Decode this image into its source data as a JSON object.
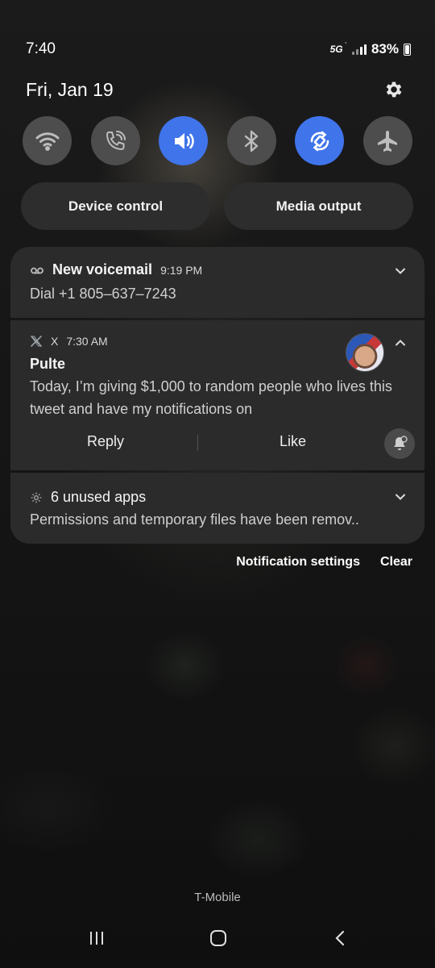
{
  "status_bar": {
    "time": "7:40",
    "network": "5G",
    "battery": "83%"
  },
  "header": {
    "date": "Fri, Jan 19"
  },
  "quick_settings": {
    "tiles": [
      {
        "name": "wifi-icon",
        "active": false
      },
      {
        "name": "wifi-calling-icon",
        "active": false
      },
      {
        "name": "sound-icon",
        "active": true
      },
      {
        "name": "bluetooth-icon",
        "active": false
      },
      {
        "name": "auto-rotate-icon",
        "active": true
      },
      {
        "name": "airplane-mode-icon",
        "active": false
      }
    ],
    "device_control": "Device control",
    "media_output": "Media output",
    "accent_color": "#3f74ea"
  },
  "notifications": [
    {
      "title": "New voicemail",
      "time": "9:19 PM",
      "body": "Dial +1 805–637–7243",
      "icon": "voicemail-icon"
    },
    {
      "app": "X",
      "time": "7:30 AM",
      "title": "Pulte",
      "body": "Today, I’m giving $1,000 to random people who lives this tweet and have my notifications on",
      "reply": "Reply",
      "like": "Like",
      "icon": "x-logo-icon"
    },
    {
      "title": "6 unused apps",
      "body": "Permissions and temporary files have been remov..",
      "icon": "gear-icon"
    }
  ],
  "footer": {
    "notification_settings": "Notification settings",
    "clear": "Clear",
    "carrier": "T-Mobile"
  }
}
